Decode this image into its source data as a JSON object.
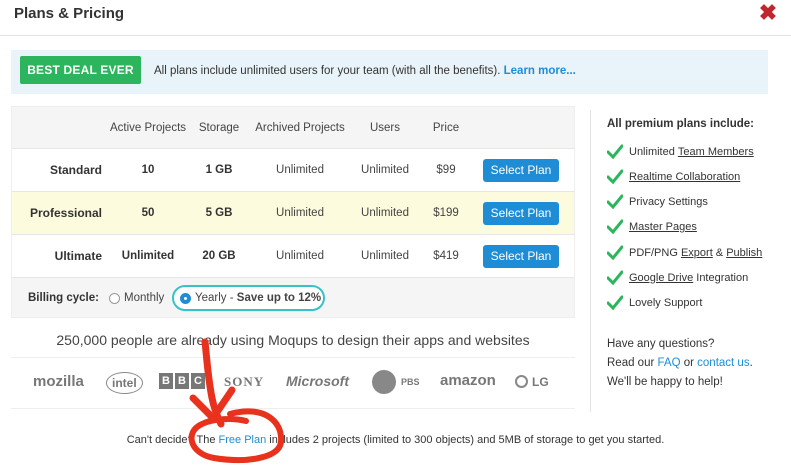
{
  "header": {
    "title": "Plans & Pricing",
    "close_icon": "close-icon"
  },
  "deal": {
    "badge": "BEST DEAL EVER",
    "text": "All plans include unlimited users for your team (with all the benefits).",
    "link": "Learn more..."
  },
  "table": {
    "columns": [
      "Active Projects",
      "Storage",
      "Archived Projects",
      "Users",
      "Price"
    ],
    "rows": [
      {
        "name": "Standard",
        "projects": "10",
        "storage": "1 GB",
        "archived": "Unlimited",
        "users": "Unlimited",
        "price": "$99",
        "button": "Select Plan"
      },
      {
        "name": "Professional",
        "projects": "50",
        "storage": "5 GB",
        "archived": "Unlimited",
        "users": "Unlimited",
        "price": "$199",
        "button": "Select Plan"
      },
      {
        "name": "Ultimate",
        "projects": "Unlimited",
        "storage": "20 GB",
        "archived": "Unlimited",
        "users": "Unlimited",
        "price": "$419",
        "button": "Select Plan"
      }
    ],
    "billing": {
      "label": "Billing cycle:",
      "monthly": "Monthly",
      "yearly": "Yearly",
      "yearly_sep": " - ",
      "yearly_save": "Save up to 12%",
      "selected": "yearly"
    }
  },
  "social_proof": "250,000 people are already using Moqups to design their apps and websites",
  "logos": {
    "mozilla": "mozilla",
    "intel": "intel",
    "bbc": [
      "B",
      "B",
      "C"
    ],
    "sony": "SONY",
    "microsoft": "Microsoft",
    "pbs": "PBS",
    "amazon": "amazon",
    "lg": "LG"
  },
  "footer": {
    "before": "Can't decide? The ",
    "link": "Free Plan",
    "after": " includes 2 projects (limited to 300 objects) and 5MB of storage to get you started."
  },
  "sidebar": {
    "title": "All premium plans include:",
    "features": [
      {
        "pre": "Unlimited ",
        "link": "Team Members",
        "post": ""
      },
      {
        "pre": "",
        "link": "Realtime Collaboration",
        "post": ""
      },
      {
        "pre": "Privacy Settings",
        "link": "",
        "post": ""
      },
      {
        "pre": "",
        "link": "Master Pages",
        "post": ""
      },
      {
        "pre": "PDF/PNG ",
        "link": "Export",
        "mid": " & ",
        "link2": "Publish",
        "post": ""
      },
      {
        "pre": "",
        "link": "Google Drive",
        "post": " Integration"
      },
      {
        "pre": "Lovely Support",
        "link": "",
        "post": ""
      }
    ],
    "questions": {
      "line1": "Have any questions?",
      "read": "Read our ",
      "faq": "FAQ",
      "or": " or ",
      "contact": "contact us",
      "dot": ".",
      "line3": "We'll be happy to help!"
    }
  },
  "colors": {
    "brand_blue": "#1f8dd6",
    "green": "#2db55d",
    "close_red": "#c0262d",
    "annotation_red": "#e8321e",
    "yearly_outline": "#35c3c8"
  }
}
